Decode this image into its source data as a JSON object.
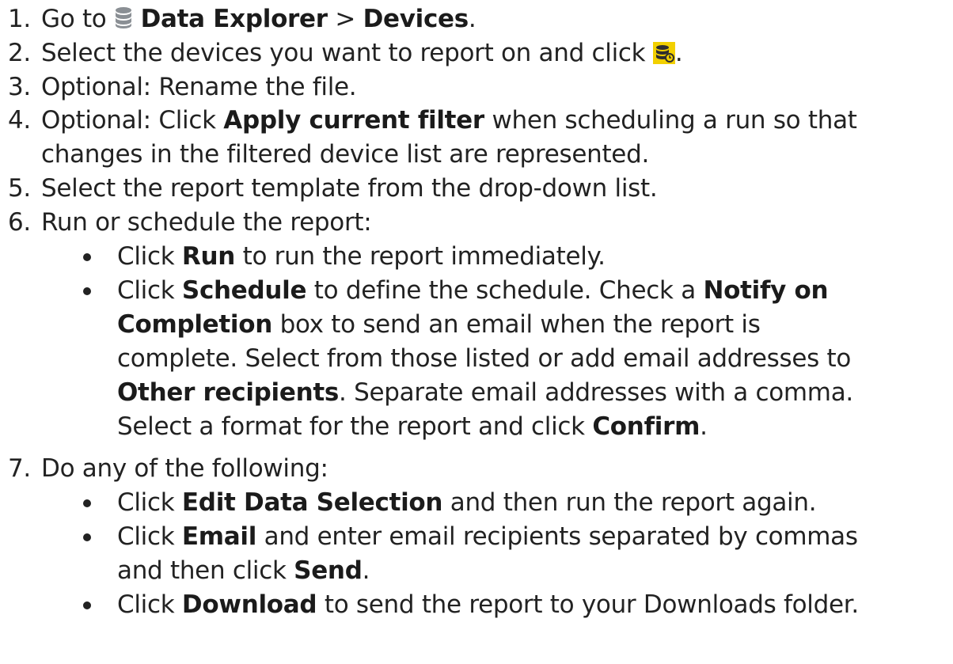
{
  "steps": [
    {
      "number": "1.",
      "parts": [
        "Go to ",
        "Data Explorer",
        " > ",
        "Devices",
        "."
      ],
      "icon": "database-icon"
    },
    {
      "number": "2.",
      "parts": [
        "Select the devices you want to report on and click ",
        "."
      ],
      "icon": "report-icon"
    },
    {
      "number": "3.",
      "text": "Optional: Rename the file."
    },
    {
      "number": "4.",
      "parts": [
        "Optional: Click ",
        "Apply current filter",
        " when scheduling a run so that"
      ],
      "continuation": "changes in the filtered device list are represented."
    },
    {
      "number": "5.",
      "text": "Select the report template from the drop-down list."
    },
    {
      "number": "6.",
      "text": "Run or schedule the report:",
      "bullets": [
        {
          "lines": [
            [
              "Click ",
              "Run",
              " to run the report immediately."
            ]
          ]
        },
        {
          "lines": [
            [
              "Click ",
              "Schedule",
              " to define the schedule. Check a ",
              "Notify on"
            ],
            [
              "Completion",
              " box to send an email when the report is"
            ],
            [
              "complete. Select from those listed or add email addresses to"
            ],
            [
              "Other recipients",
              ". Separate email addresses with a comma."
            ],
            [
              "Select a format for the report and click ",
              "Confirm",
              "."
            ]
          ]
        }
      ]
    },
    {
      "number": "7.",
      "text": "Do any of the following:",
      "bullets": [
        {
          "lines": [
            [
              "Click ",
              "Edit Data Selection",
              " and then run the report again."
            ]
          ]
        },
        {
          "lines": [
            [
              "Click ",
              "Email",
              " and enter email recipients separated by commas"
            ],
            [
              "and then click ",
              "Send",
              "."
            ]
          ]
        },
        {
          "lines": [
            [
              "Click ",
              "Download",
              " to send the report to your Downloads folder."
            ]
          ]
        }
      ]
    }
  ],
  "colors": {
    "text": "#222222",
    "icon_db": "#8a8f94",
    "icon_report_bg": "#f2d000",
    "icon_report_fg": "#2e2e2e"
  }
}
